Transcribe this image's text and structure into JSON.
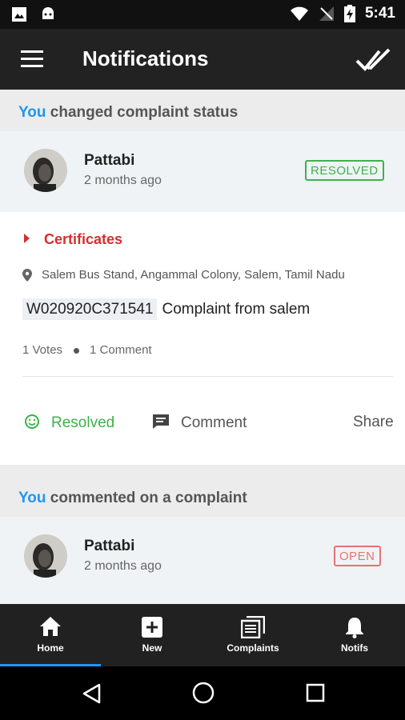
{
  "status_bar": {
    "time": "5:41"
  },
  "app_bar": {
    "title": "Notifications"
  },
  "notifications": [
    {
      "you": "You",
      "action_text": "changed complaint status",
      "user": "Pattabi",
      "time": "2 months ago",
      "status": "RESOLVED",
      "status_color": "#3cb34a",
      "category": "Certificates",
      "location": "Salem Bus Stand, Angammal Colony, Salem, Tamil Nadu",
      "complaint_id": "W020920C371541",
      "complaint_title": "Complaint from salem",
      "votes": "1 Votes",
      "comments": "1 Comment",
      "actions": {
        "resolved": "Resolved",
        "comment": "Comment",
        "share": "Share"
      }
    },
    {
      "you": "You",
      "action_text": "commented on a complaint",
      "user": "Pattabi",
      "time": "2 months ago",
      "status": "OPEN",
      "status_color": "#e57373"
    }
  ],
  "bottom_nav": [
    {
      "label": "Home",
      "icon": "home-icon",
      "active": true
    },
    {
      "label": "New",
      "icon": "add-box-icon"
    },
    {
      "label": "Complaints",
      "icon": "list-icon"
    },
    {
      "label": "Notifs",
      "icon": "bell-icon"
    }
  ],
  "colors": {
    "accent": "#2196f3",
    "category": "#d32f2f",
    "resolved": "#3cb34a",
    "open": "#e57373",
    "appbar": "#222222"
  }
}
